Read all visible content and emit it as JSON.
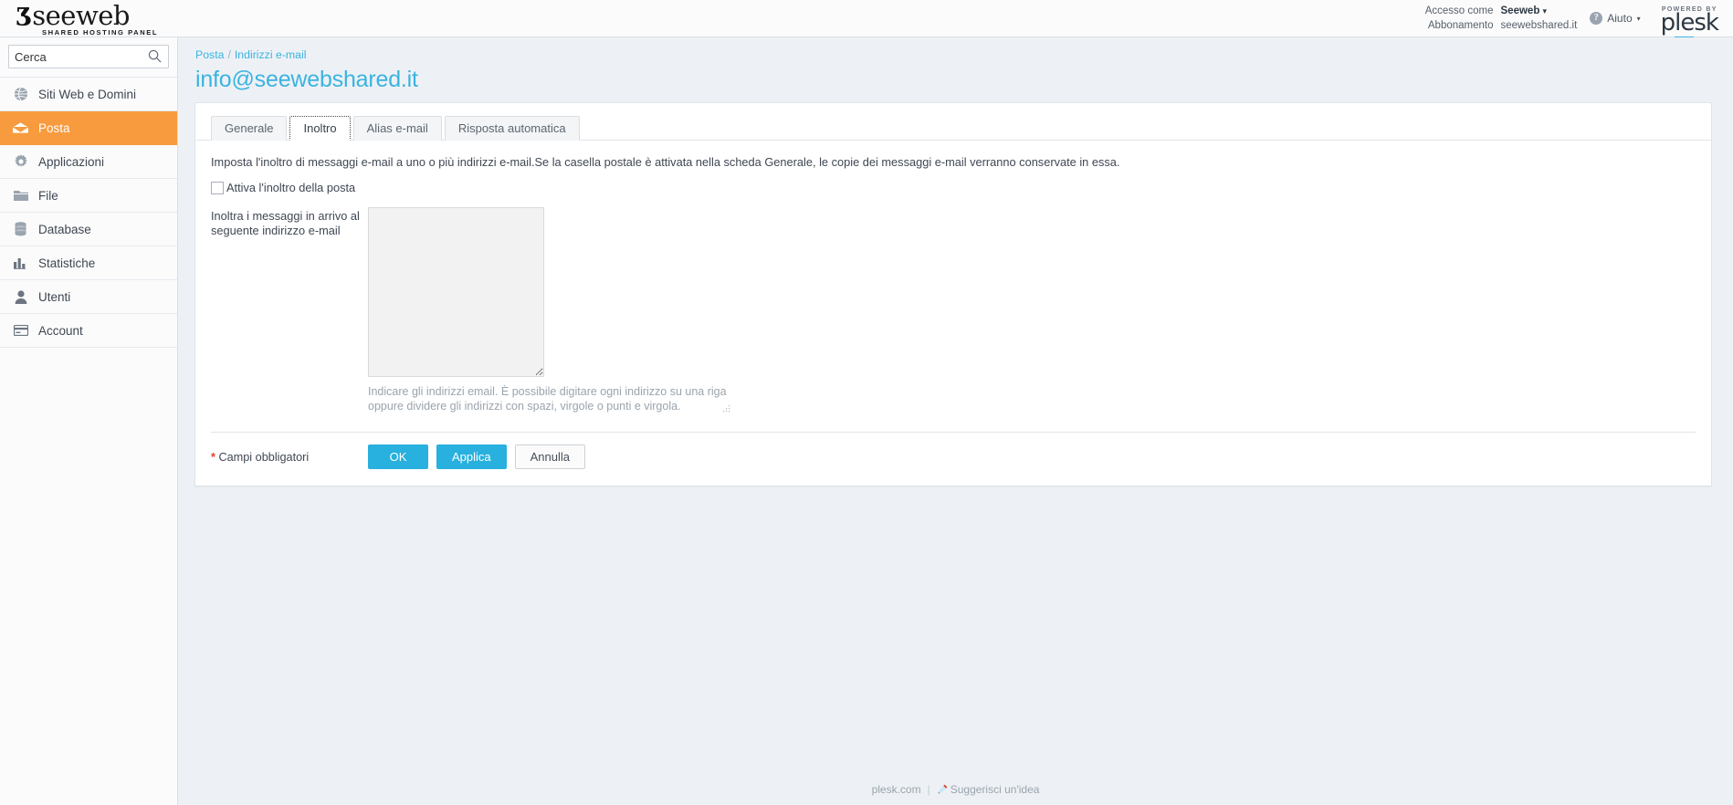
{
  "header": {
    "brand_name": "seeweb",
    "brand_tagline": "SHARED HOSTING PANEL",
    "account_label": "Accesso come",
    "account_name": "Seeweb",
    "subscription_label": "Abbonamento",
    "subscription_value": "seewebshared.it",
    "help_label": "Aiuto",
    "powered_by": "POWERED BY",
    "plesk_p": "p",
    "plesk_le": "le",
    "plesk_sk": "sk",
    "accent_blue": "#3fb8e0",
    "caret": "▾"
  },
  "sidebar": {
    "search": {
      "value": "Cerca",
      "placeholder": "Cerca",
      "icon": "search-icon"
    },
    "items": [
      {
        "label": "Siti Web e Domini",
        "icon": "globe-icon",
        "active": false
      },
      {
        "label": "Posta",
        "icon": "mail-icon",
        "active": true
      },
      {
        "label": "Applicazioni",
        "icon": "gear-icon",
        "active": false
      },
      {
        "label": "File",
        "icon": "folder-icon",
        "active": false
      },
      {
        "label": "Database",
        "icon": "database-icon",
        "active": false
      },
      {
        "label": "Statistiche",
        "icon": "bar-chart-icon",
        "active": false
      },
      {
        "label": "Utenti",
        "icon": "user-icon",
        "active": false
      },
      {
        "label": "Account",
        "icon": "card-icon",
        "active": false
      }
    ],
    "active_color": "#f79b3e"
  },
  "breadcrumb": {
    "first": "Posta",
    "separator": "/",
    "second": "Indirizzi e-mail"
  },
  "page": {
    "title": "info@seewebshared.it"
  },
  "tabs": [
    {
      "label": "Generale",
      "active": false
    },
    {
      "label": "Inoltro",
      "active": true
    },
    {
      "label": "Alias e-mail",
      "active": false
    },
    {
      "label": "Risposta automatica",
      "active": false
    }
  ],
  "form": {
    "description": "Imposta l'inoltro di messaggi e-mail a uno o più indirizzi e-mail.Se la casella postale è attivata nella scheda Generale, le copie dei messaggi e-mail verranno conservate in essa.",
    "checkbox_label": "Attiva l'inoltro della posta",
    "checkbox_checked": false,
    "field_label": "Inoltra i messaggi in arrivo al seguente indirizzo e-mail",
    "textarea_value": "",
    "textarea_disabled": true,
    "hint": "Indicare gli indirizzi email. È possibile digitare ogni indirizzo su una riga oppure dividere gli indirizzi con spazi, virgole o punti e virgola.",
    "required_star": "*",
    "required_note": "Campi obbligatori"
  },
  "buttons": {
    "ok": "OK",
    "apply": "Applica",
    "cancel": "Annulla",
    "primary_color": "#28b0de"
  },
  "footer": {
    "link": "plesk.com",
    "separator": "|",
    "idea_label": "Suggerisci un'idea",
    "idea_icon": "pencil-icon"
  }
}
